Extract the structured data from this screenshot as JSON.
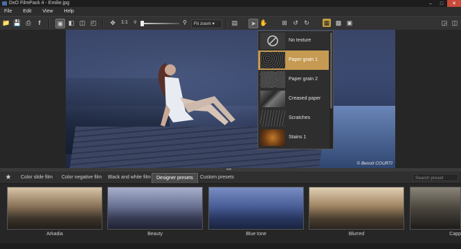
{
  "window": {
    "title": "DxO FilmPack 4 - Emilie.jpg"
  },
  "menu": [
    "File",
    "Edit",
    "View",
    "Help"
  ],
  "toolbar": {
    "zoom_ratio": "1:1",
    "zoom_mode": "Fit zoom",
    "zoom_level": 0.0
  },
  "photo": {
    "credit": "© Benoit COURTI"
  },
  "textures": [
    {
      "label": "No texture",
      "selected": false
    },
    {
      "label": "Paper grain 1",
      "selected": true
    },
    {
      "label": "Paper grain 2",
      "selected": false
    },
    {
      "label": "Creased paper",
      "selected": false
    },
    {
      "label": "Scratches",
      "selected": false
    },
    {
      "label": "Stains 1",
      "selected": false
    }
  ],
  "tabs": [
    {
      "label": "Color slide film",
      "active": false
    },
    {
      "label": "Color negative film",
      "active": false
    },
    {
      "label": "Black and white film",
      "active": false
    },
    {
      "label": "Designer presets",
      "active": true
    },
    {
      "label": "Custom presets",
      "active": false
    }
  ],
  "search": {
    "placeholder": "Search preset"
  },
  "presets": [
    {
      "caption": "Arkadia",
      "tint": "#b8a184"
    },
    {
      "caption": "Beauty",
      "tint": "#8a92b3"
    },
    {
      "caption": "Blue tone",
      "tint": "#5a6ea8"
    },
    {
      "caption": "Blurred",
      "tint": "#b89c7c"
    },
    {
      "caption": "Capp",
      "tint": "#4a4640"
    }
  ],
  "colors": {
    "accent": "#c69a52",
    "close": "#c84a3a"
  }
}
